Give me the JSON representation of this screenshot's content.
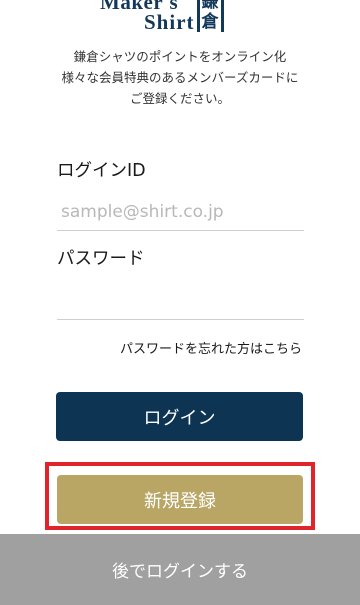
{
  "logo": {
    "word1": "Maker's",
    "word2": "Shirt",
    "kanji1": "鎌",
    "kanji2": "倉"
  },
  "intro": {
    "line1": "鎌倉シャツのポイントをオンライン化",
    "line2": "様々な会員特典のあるメンバーズカードに",
    "line3": "ご登録ください。"
  },
  "form": {
    "id_label": "ログインID",
    "id_placeholder": "sample@shirt.co.jp",
    "id_value": "",
    "password_label": "パスワード",
    "password_value": "",
    "forgot_link": "パスワードを忘れた方はこちら"
  },
  "buttons": {
    "login": "ログイン",
    "register": "新規登録",
    "later": "後でログインする"
  },
  "colors": {
    "brand_navy": "#0d3553",
    "register_gold": "#b9a665",
    "later_gray": "#a0a0a0",
    "highlight_red": "#e0242c"
  }
}
